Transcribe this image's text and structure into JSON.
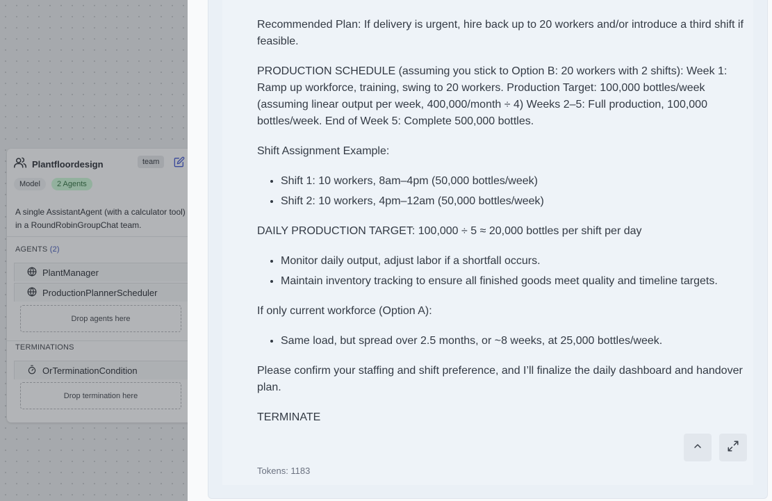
{
  "team_node": {
    "title": "Plantfloordesign",
    "type_badge": "team",
    "model_chip": "Model",
    "agents_chip": "2 Agents",
    "description": "A single AssistantAgent (with a calculator tool) in a RoundRobinGroupChat team.",
    "agents_section_label": "AGENTS",
    "agents_count": "(2)",
    "agents": [
      {
        "name": "PlantManager"
      },
      {
        "name": "ProductionPlannerScheduler"
      }
    ],
    "drop_agents_label": "Drop agents here",
    "terminations_section_label": "TERMINATIONS",
    "termination": "OrTerminationCondition",
    "drop_termination_label": "Drop termination here"
  },
  "message": {
    "cut_top_line": "…    … ….   ……,    …",
    "recommended_plan": "Recommended Plan: If delivery is urgent, hire back up to 20 workers and/or introduce a third shift if feasible.",
    "production_schedule": "PRODUCTION SCHEDULE (assuming you stick to Option B: 20 workers with 2 shifts): Week 1: Ramp up workforce, training, swing to 20 workers. Production Target: 100,000 bottles/week (assuming linear output per week, 400,000/month ÷ 4) Weeks 2–5: Full production, 100,000 bottles/week. End of Week 5: Complete 500,000 bottles.",
    "shift_example_heading": "Shift Assignment Example:",
    "shifts": [
      "Shift 1: 10 workers, 8am–4pm (50,000 bottles/week)",
      "Shift 2: 10 workers, 4pm–12am (50,000 bottles/week)"
    ],
    "daily_target": "DAILY PRODUCTION TARGET: 100,000 ÷ 5 ≈ 20,000 bottles per shift per day",
    "daily_bullets": [
      "Monitor daily output, adjust labor if a shortfall occurs.",
      "Maintain inventory tracking to ensure all finished goods meet quality and timeline targets."
    ],
    "option_a_heading": "If only current workforce (Option A):",
    "option_a_bullets": [
      "Same load, but spread over 2.5 months, or ~8 weeks, at 25,000 bottles/week."
    ],
    "confirm": "Please confirm your staffing and shift preference, and I’ll finalize the daily dashboard and handover plan.",
    "terminate": "TERMINATE",
    "tokens": "Tokens: 1183"
  }
}
